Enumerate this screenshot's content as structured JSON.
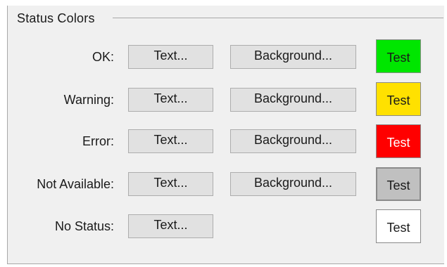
{
  "group_title": "Status Colors",
  "rows": [
    {
      "label": "OK:",
      "text_btn": "Text...",
      "bg_btn": "Background...",
      "test": "Test",
      "bg_color": "#00e600",
      "fg_color": "#1a1a1a"
    },
    {
      "label": "Warning:",
      "text_btn": "Text...",
      "bg_btn": "Background...",
      "test": "Test",
      "bg_color": "#ffe100",
      "fg_color": "#1a1a1a"
    },
    {
      "label": "Error:",
      "text_btn": "Text...",
      "bg_btn": "Background...",
      "test": "Test",
      "bg_color": "#ff0000",
      "fg_color": "#ffffff"
    },
    {
      "label": "Not Available:",
      "text_btn": "Text...",
      "bg_btn": "Background...",
      "test": "Test",
      "bg_color": "#c0c0c0",
      "fg_color": "#1a1a1a"
    },
    {
      "label": "No Status:",
      "text_btn": "Text...",
      "test": "Test",
      "bg_color": "#ffffff",
      "fg_color": "#1a1a1a"
    }
  ]
}
